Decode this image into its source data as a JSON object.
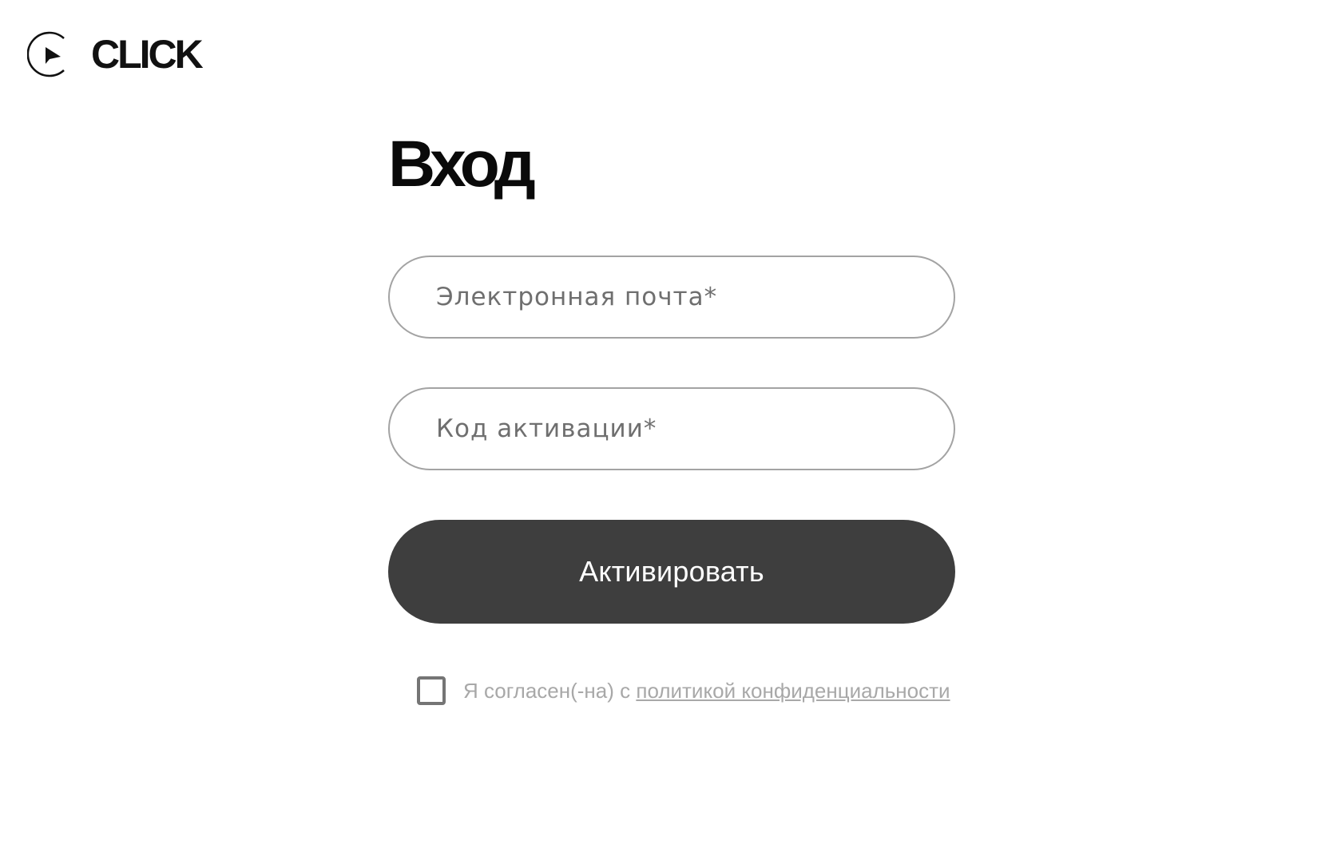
{
  "header": {
    "logo_text": "CLICK",
    "logo_icon": "play-circle-icon"
  },
  "login": {
    "title": "Вход",
    "email_placeholder": "Электронная почта*",
    "email_value": "",
    "code_placeholder": "Код активации*",
    "code_value": "",
    "submit_label": "Активировать",
    "consent_checked": false,
    "consent_prefix": "Я согласен(-на) с ",
    "consent_link": "политикой конфиденциальности"
  },
  "colors": {
    "button_background": "#3e3e3e",
    "input_border": "#a3a3a3",
    "consent_text": "#a8a8a8"
  }
}
